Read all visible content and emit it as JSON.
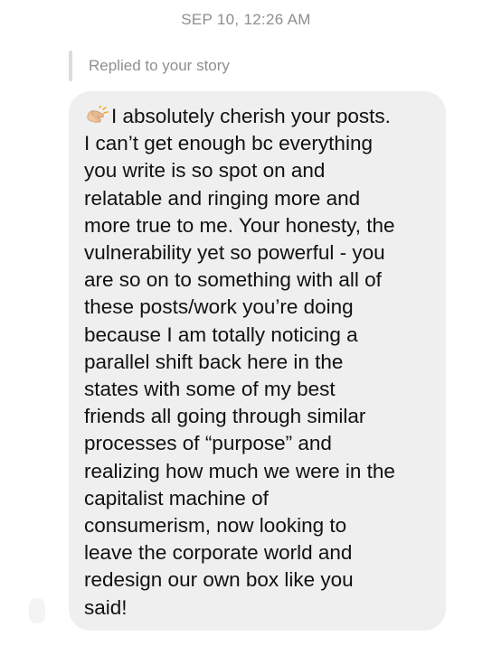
{
  "thread": {
    "timestamp": "SEP 10, 12:26 AM",
    "reply_label": "Replied to your story"
  },
  "message": {
    "emoji": "clapping-hands-icon",
    "text": "I absolutely cherish your posts.\nI can’t get enough bc everything\nyou write is so spot on and\nrelatable and ringing more and\nmore true to me. Your honesty, the\nvulnerability yet so powerful - you\nare so on to something with all of\nthese posts/work you’re doing\nbecause I am totally noticing a\nparallel shift back here in the\nstates with some of my best\nfriends all going through similar\nprocesses of “purpose” and\nrealizing how much we were in the\ncapitalist machine of\nconsumerism,  now looking to\nleave the corporate world and\nredesign our own box like you\nsaid!"
  },
  "colors": {
    "bubble": "#efefef",
    "muted_text": "#8e8e93",
    "message_text": "#111111"
  }
}
